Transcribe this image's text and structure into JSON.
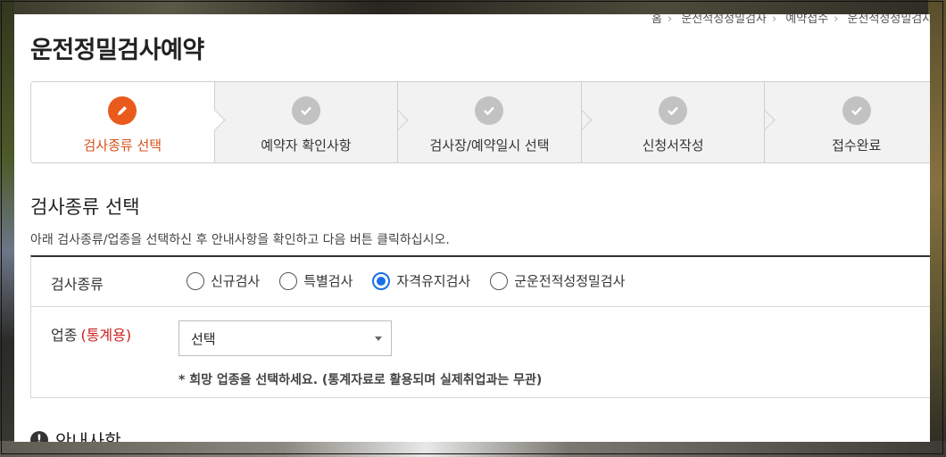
{
  "breadcrumb": [
    "홈",
    "운전적성정밀검사",
    "예약접수",
    "운전적성정밀검사"
  ],
  "page_title": "운전정밀검사예약",
  "steps": [
    {
      "label": "검사종류 선택",
      "icon": "pencil-icon",
      "active": true
    },
    {
      "label": "예약자 확인사항",
      "icon": "check-icon",
      "active": false
    },
    {
      "label": "검사장/예약일시 선택",
      "icon": "check-icon",
      "active": false
    },
    {
      "label": "신청서작성",
      "icon": "check-icon",
      "active": false
    },
    {
      "label": "접수완료",
      "icon": "check-icon",
      "active": false
    }
  ],
  "section": {
    "title": "검사종류 선택",
    "description": "아래 검사종류/업종을 선택하신 후 안내사항을 확인하고 다음 버튼 클릭하십시오."
  },
  "form": {
    "type_label": "검사종류",
    "type_options": [
      {
        "label": "신규검사",
        "checked": false
      },
      {
        "label": "특별검사",
        "checked": false
      },
      {
        "label": "자격유지검사",
        "checked": true
      },
      {
        "label": "군운전적성정밀검사",
        "checked": false
      }
    ],
    "industry_label": "업종",
    "industry_required": "(통계용)",
    "industry_select_value": "선택",
    "industry_hint": "* 희망 업종을 선택하세요. (통계자료로 활용되며 실제취업과는 무관)"
  },
  "info": {
    "icon": "!",
    "label": "안내사항"
  },
  "colors": {
    "accent_active": "#ea5a1c",
    "step_inactive": "#c2c2c2",
    "radio_checked": "#1a6ee8",
    "required": "#c8221f"
  }
}
